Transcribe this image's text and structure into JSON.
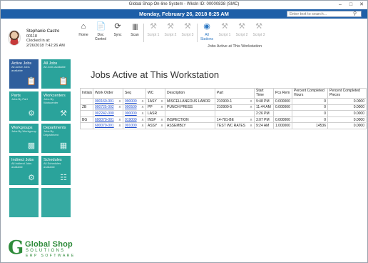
{
  "window": {
    "title": "Global Shop On-line System - WksIn ID: 00000838 (SMC)"
  },
  "header": {
    "datetime": "Monday, February 26, 2018 8:25 AM",
    "search_placeholder": "Enter text to search..."
  },
  "user": {
    "name": "Stephanie Castro",
    "id": "00118",
    "clocked_label": "Clocked in at:",
    "clocked_time": "2/26/2018 7:42:26 AM"
  },
  "toolbar": {
    "buttons": [
      {
        "label": "Home",
        "icon": "home-icon",
        "state": "normal"
      },
      {
        "label": "Doc Control",
        "icon": "document-icon",
        "state": "normal"
      },
      {
        "label": "Sync",
        "icon": "sync-icon",
        "state": "normal"
      },
      {
        "label": "Scan",
        "icon": "barcode-icon",
        "state": "normal"
      },
      {
        "label": "Script 1",
        "icon": "tools-icon",
        "state": "disabled"
      },
      {
        "label": "Script 2",
        "icon": "tools-icon",
        "state": "disabled"
      },
      {
        "label": "Script 3",
        "icon": "tools-icon",
        "state": "disabled"
      },
      {
        "label": "All Stations",
        "icon": "eye-icon",
        "state": "active"
      },
      {
        "label": "Script 1",
        "icon": "tools-icon",
        "state": "disabled"
      },
      {
        "label": "Script 2",
        "icon": "tools-icon",
        "state": "disabled"
      },
      {
        "label": "Script 3",
        "icon": "tools-icon",
        "state": "disabled"
      }
    ],
    "subtitle": "Jobs Active at This Workstation"
  },
  "tiles": [
    {
      "title": "Active Jobs",
      "desc": "All active Jobs available",
      "icon": "clipboard-icon",
      "selected": true
    },
    {
      "title": "All Jobs",
      "desc": "All Jobs available",
      "icon": "clipboard-icon",
      "selected": false
    },
    {
      "title": "Parts",
      "desc": "Jobs By Part",
      "icon": "parts-icon",
      "selected": false
    },
    {
      "title": "Workcenters",
      "desc": "Jobs By Workcenter",
      "icon": "workcenter-icon",
      "selected": false
    },
    {
      "title": "Workgroups",
      "desc": "Jobs By Workgroup",
      "icon": "group-icon",
      "selected": false
    },
    {
      "title": "Departments",
      "desc": "Jobs By Department",
      "icon": "department-icon",
      "selected": false
    },
    {
      "title": "Indirect Jobs",
      "desc": "All Indirect Jobs available",
      "icon": "gear-icon",
      "selected": false
    },
    {
      "title": "Schedules",
      "desc": "All Schedules available",
      "icon": "calendar-icon",
      "selected": false
    },
    {
      "title": "",
      "desc": "",
      "icon": "",
      "selected": false
    },
    {
      "title": "",
      "desc": "",
      "icon": "",
      "selected": false
    }
  ],
  "logo": {
    "line1": "Global Shop",
    "line2": "SOLUTIONS",
    "line3": "ERP SOFTWARE"
  },
  "main": {
    "title": "Jobs Active at This Workstation",
    "columns": [
      "Initials",
      "Work Order",
      "Seq",
      "WC",
      "Description",
      "Part",
      "Start Time",
      "Pcs Rem",
      "Percent Completed Hours",
      "Percent Completed Pieces"
    ],
    "rows": [
      {
        "initials": "",
        "wo": "000160-001",
        "seq": "990000",
        "wc": "1ASY",
        "desc": "MISCELLANEOUS LABOR",
        "part": "210900-1",
        "start": "9:48 PM",
        "pcs": "0.000000",
        "pch": "0",
        "pcp": "0.0000"
      },
      {
        "initials": "ZB",
        "wo": "000725-002",
        "seq": "000500",
        "wc": "PP",
        "desc": "PUNCH PRESS",
        "part": "210900-5",
        "start": "11:44 AM",
        "pcs": "0.000000",
        "pch": "0",
        "pcp": "0.0000"
      },
      {
        "initials": "",
        "wo": "002242-000",
        "seq": "000000",
        "wc": "LASR",
        "desc": "",
        "part": "",
        "start": "2:26 PM",
        "pcs": "",
        "pch": "0",
        "pcp": "0.0000"
      },
      {
        "initials": "BG",
        "wo": "600070-001",
        "seq": "019000",
        "wc": "INSP",
        "desc": "INSPECTION",
        "part": "14-781-BE",
        "start": "3:07 PM",
        "pcs": "0.000000",
        "pch": "0",
        "pcp": "0.0000"
      },
      {
        "initials": "",
        "wo": "600070-001",
        "seq": "001000",
        "wc": "ASSY",
        "desc": "ASSEMBLY",
        "part": "TEST WC RATES",
        "start": "9:24 AM",
        "pcs": "1.000000",
        "pch": "14536",
        "pcp": "0.0000"
      }
    ]
  }
}
